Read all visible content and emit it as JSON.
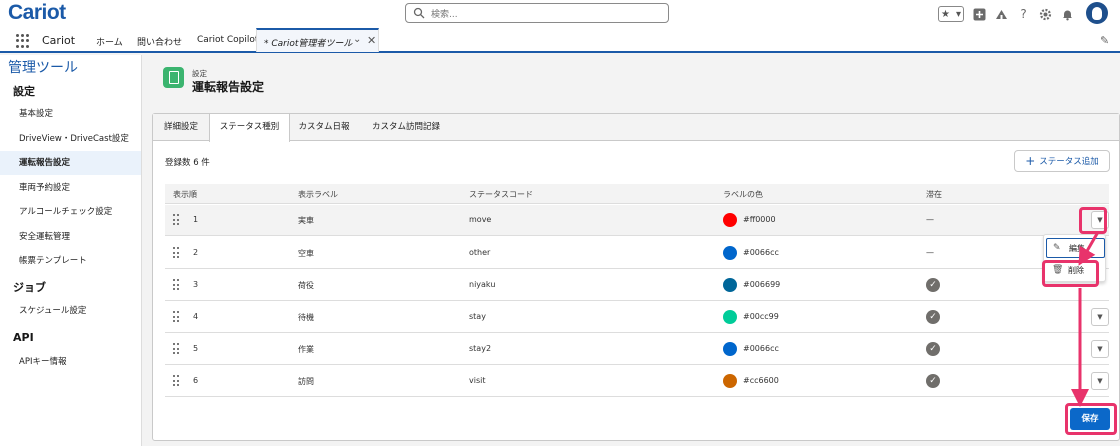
{
  "app": {
    "logo": "Cariot",
    "search_placeholder": "検索...",
    "app_name": "Cariot",
    "nav_items": [
      "ホーム",
      "問い合わせ",
      "Cariot Copilot"
    ],
    "active_tab": "* Cariot管理者ツール"
  },
  "sidebar": {
    "title": "管理ツール",
    "sections": [
      {
        "heading": "設定",
        "items": [
          "基本設定",
          "DriveView・DriveCast設定",
          "運転報告設定",
          "車両予約設定",
          "アルコールチェック設定",
          "安全運転管理",
          "帳票テンプレート"
        ]
      },
      {
        "heading": "ジョブ",
        "items": [
          "スケジュール設定"
        ]
      },
      {
        "heading": "API",
        "items": [
          "APIキー情報"
        ]
      }
    ],
    "active_item": "運転報告設定"
  },
  "header": {
    "subtitle": "設定",
    "title": "運転報告設定"
  },
  "tabs": [
    "詳細設定",
    "ステータス種別",
    "カスタム日報",
    "カスタム訪問記録"
  ],
  "active_tab": "ステータス種別",
  "list": {
    "count_label": "登録数 6 件",
    "add_button": "ステータス追加",
    "columns": [
      "表示順",
      "表示ラベル",
      "ステータスコード",
      "ラベルの色",
      "滞在"
    ],
    "rows": [
      {
        "order": "1",
        "label": "実車",
        "code": "move",
        "color": "#ff0000",
        "stay": "—"
      },
      {
        "order": "2",
        "label": "空車",
        "code": "other",
        "color": "#0066cc",
        "stay": "—"
      },
      {
        "order": "3",
        "label": "荷役",
        "code": "niyaku",
        "color": "#006699",
        "stay": "check"
      },
      {
        "order": "4",
        "label": "待機",
        "code": "stay",
        "color": "#00cc99",
        "stay": "check"
      },
      {
        "order": "5",
        "label": "作業",
        "code": "stay2",
        "color": "#0066cc",
        "stay": "check"
      },
      {
        "order": "6",
        "label": "訪問",
        "code": "visit",
        "color": "#cc6600",
        "stay": "check"
      }
    ]
  },
  "row_menu": {
    "edit": "編集",
    "delete": "削除"
  },
  "save_button": "保存",
  "annotation_color": "#e8336b"
}
